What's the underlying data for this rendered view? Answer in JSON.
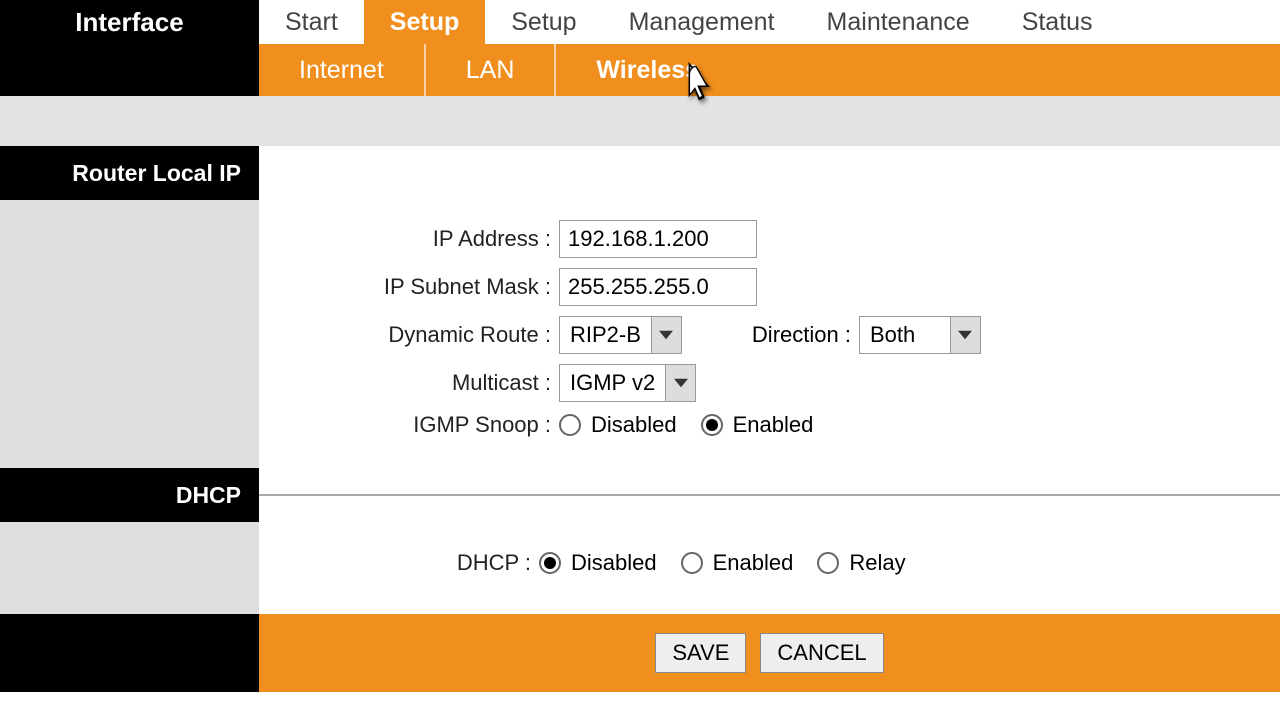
{
  "logo": "Interface",
  "mainTabs": {
    "start": "Start",
    "setup1": "Setup",
    "setup2": "Setup",
    "management": "Management",
    "maintenance": "Maintenance",
    "status": "Status"
  },
  "subTabs": {
    "internet": "Internet",
    "lan": "LAN",
    "wireless": "Wireless"
  },
  "sections": {
    "routerLocalIp": "Router Local IP",
    "dhcp": "DHCP"
  },
  "labels": {
    "ipAddress": "IP Address :",
    "ipSubnetMask": "IP Subnet Mask :",
    "dynamicRoute": "Dynamic Route :",
    "direction": "Direction :",
    "multicast": "Multicast :",
    "igmpSnoop": "IGMP Snoop :",
    "dhcp": "DHCP :"
  },
  "values": {
    "ipAddress": "192.168.1.200",
    "ipSubnetMask": "255.255.255.0",
    "dynamicRoute": "RIP2-B",
    "direction": "Both",
    "multicast": "IGMP v2"
  },
  "radios": {
    "disabled": "Disabled",
    "enabled": "Enabled",
    "relay": "Relay"
  },
  "buttons": {
    "save": "SAVE",
    "cancel": "CANCEL"
  }
}
